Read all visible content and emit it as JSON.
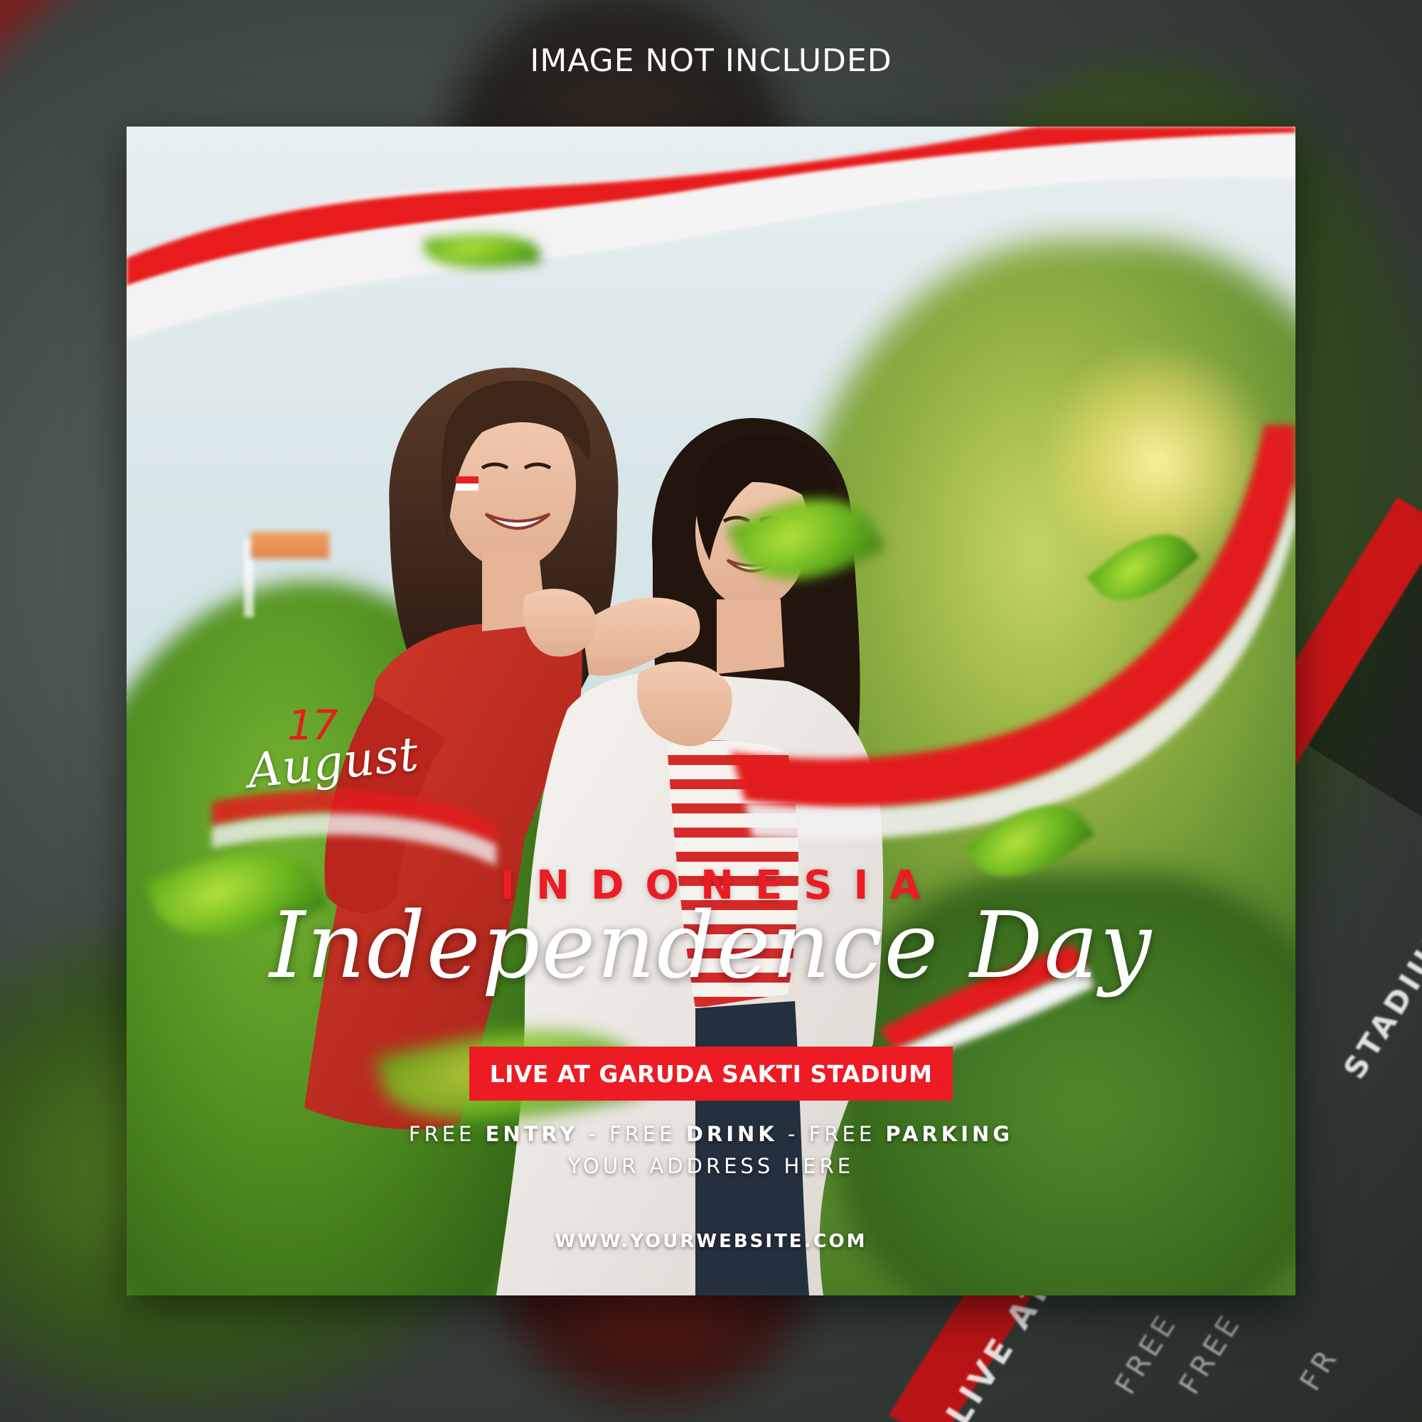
{
  "caption": "IMAGE NOT INCLUDED",
  "poster": {
    "date_day": "17",
    "date_month": "August",
    "headline_country": "INDONESIA",
    "headline_script": "Independence Day",
    "venue": "LIVE AT GARUDA SAKTI STADIUM",
    "perks": [
      {
        "prefix": "FREE",
        "item": "ENTRY"
      },
      {
        "prefix": "FREE",
        "item": "DRINK"
      },
      {
        "prefix": "FREE",
        "item": "PARKING"
      }
    ],
    "perk_separator": " - ",
    "address": "YOUR ADDRESS HERE",
    "website": "WWW.YOURWEBSITE.COM"
  },
  "background_ghost": {
    "stadium": "STADIUM",
    "live": "LIVE AT",
    "free_a": "FREE",
    "free_b": "FREE",
    "free_c": "FR"
  },
  "colors": {
    "brand_red": "#ed1b24",
    "text_white": "#ffffff",
    "leaf_green": "#6cb71f"
  }
}
